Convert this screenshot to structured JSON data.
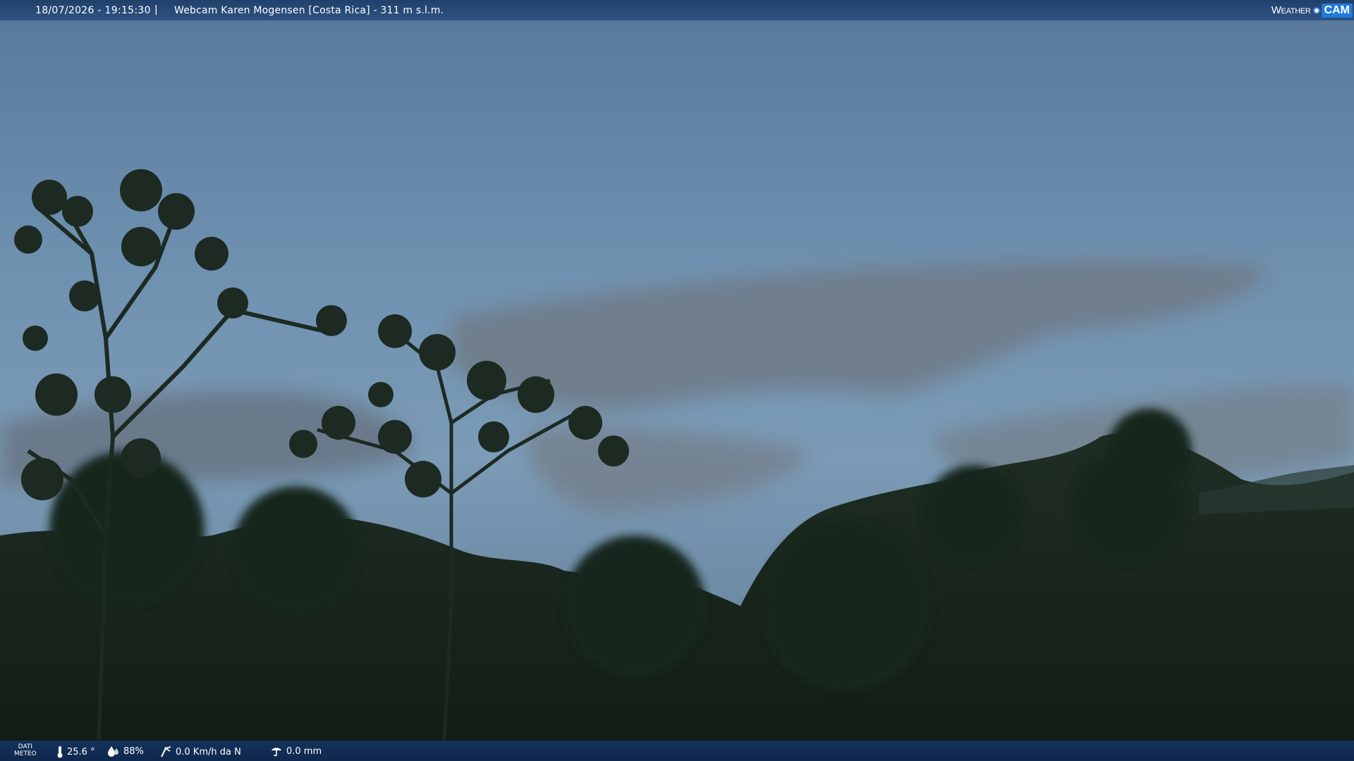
{
  "header": {
    "datetime": "18/07/2026 - 19:15:30",
    "separator": "|",
    "title": "Webcam Karen Mogensen [Costa Rica]  - 311 m s.l.m.",
    "logo": {
      "weather": "Weather",
      "cam": "CAM"
    }
  },
  "footer": {
    "label": "DATI METEO",
    "label_line1": "DATI",
    "label_line2": "METEO",
    "temperature": "25.6 °",
    "humidity": "88%",
    "wind": "0.0 Km/h da N",
    "rain": "0.0 mm",
    "icons": [
      "thermometer-icon",
      "humidity-icon",
      "wind-icon",
      "rain-icon"
    ]
  },
  "colors": {
    "bar": "#1c3c68",
    "sky_top": "#5f7f9e",
    "sky_mid": "#7a9bb8",
    "vegetation": "#17241c",
    "logo_accent": "#1f7ad8"
  }
}
